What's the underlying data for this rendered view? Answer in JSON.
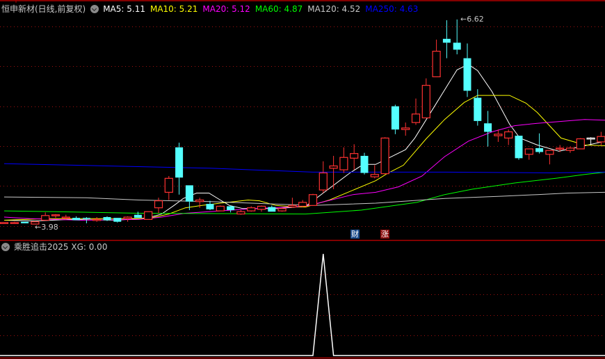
{
  "header": {
    "title": "恒申新材(日线,前复权)",
    "ma": [
      {
        "label": "MA5: 5.11",
        "color": "#ffffff"
      },
      {
        "label": "MA10: 5.21",
        "color": "#ffff00"
      },
      {
        "label": "MA20: 5.12",
        "color": "#ff00ff"
      },
      {
        "label": "MA60: 4.87",
        "color": "#00ff00"
      },
      {
        "label": "MA120: 4.52",
        "color": "#c8c8c8"
      },
      {
        "label": "MA250: 4.63",
        "color": "#0000ff"
      }
    ]
  },
  "markers": {
    "high": "6.62",
    "low": "3.98"
  },
  "badges": {
    "cai": "财",
    "zhang": "涨"
  },
  "indicator": {
    "label": "乘胜追击2025 XG: 0.00"
  },
  "colors": {
    "up": "#ff3232",
    "down": "#54ffff",
    "grid": "#8b0000",
    "separator": "#b00000"
  },
  "chart_data": {
    "type": "candlestick",
    "ohlc": [
      [
        3.99,
        4.0,
        3.99,
        4.0
      ],
      [
        3.99,
        4.01,
        3.99,
        4.0
      ],
      [
        4.01,
        4.01,
        3.99,
        3.99
      ],
      [
        3.98,
        4.01,
        3.98,
        4.01
      ],
      [
        4.03,
        4.13,
        4.03,
        4.09
      ],
      [
        4.09,
        4.11,
        4.06,
        4.1
      ],
      [
        4.07,
        4.1,
        4.04,
        4.07
      ],
      [
        4.06,
        4.08,
        4.03,
        4.03
      ],
      [
        4.06,
        4.07,
        3.99,
        4.05
      ],
      [
        4.03,
        4.07,
        4.01,
        4.04
      ],
      [
        4.07,
        4.08,
        4.02,
        4.03
      ],
      [
        4.06,
        4.06,
        4.0,
        4.01
      ],
      [
        4.05,
        4.08,
        4.01,
        4.07
      ],
      [
        4.1,
        4.14,
        4.06,
        4.06
      ],
      [
        4.04,
        4.14,
        4.04,
        4.14
      ],
      [
        4.19,
        4.32,
        4.12,
        4.28
      ],
      [
        4.39,
        4.6,
        4.29,
        4.57
      ],
      [
        4.97,
        5.03,
        4.36,
        4.58
      ],
      [
        4.48,
        4.48,
        4.16,
        4.27
      ],
      [
        4.27,
        4.32,
        4.19,
        4.29
      ],
      [
        4.24,
        4.28,
        4.16,
        4.17
      ],
      [
        4.15,
        4.22,
        4.15,
        4.21
      ],
      [
        4.21,
        4.22,
        4.13,
        4.16
      ],
      [
        4.11,
        4.16,
        4.1,
        4.14
      ],
      [
        4.15,
        4.21,
        4.14,
        4.19
      ],
      [
        4.17,
        4.22,
        4.14,
        4.21
      ],
      [
        4.2,
        4.22,
        4.14,
        4.14
      ],
      [
        4.15,
        4.19,
        4.14,
        4.18
      ],
      [
        4.2,
        4.32,
        4.19,
        4.22
      ],
      [
        4.21,
        4.29,
        4.2,
        4.26
      ],
      [
        4.22,
        4.37,
        4.22,
        4.36
      ],
      [
        4.42,
        4.79,
        4.38,
        4.64
      ],
      [
        4.7,
        4.86,
        4.43,
        4.73
      ],
      [
        4.68,
        4.97,
        4.64,
        4.84
      ],
      [
        4.83,
        5.01,
        4.68,
        4.89
      ],
      [
        4.86,
        4.9,
        4.62,
        4.64
      ],
      [
        4.59,
        4.74,
        4.57,
        4.62
      ],
      [
        4.63,
        5.1,
        4.63,
        5.09
      ],
      [
        5.5,
        5.52,
        5.14,
        5.2
      ],
      [
        5.2,
        5.29,
        5.12,
        5.22
      ],
      [
        5.29,
        5.6,
        5.26,
        5.4
      ],
      [
        5.35,
        5.86,
        5.35,
        5.77
      ],
      [
        5.88,
        6.36,
        5.88,
        6.21
      ],
      [
        6.37,
        6.61,
        6.12,
        6.32
      ],
      [
        6.32,
        6.62,
        6.17,
        6.23
      ],
      [
        6.12,
        6.31,
        5.62,
        5.7
      ],
      [
        5.61,
        5.72,
        5.25,
        5.31
      ],
      [
        5.28,
        5.44,
        4.98,
        5.17
      ],
      [
        5.12,
        5.2,
        5.04,
        5.14
      ],
      [
        5.09,
        5.2,
        5.0,
        5.17
      ],
      [
        5.12,
        5.12,
        4.81,
        4.83
      ],
      [
        4.88,
        4.95,
        4.81,
        4.95
      ],
      [
        4.96,
        5.15,
        4.89,
        4.91
      ],
      [
        4.88,
        4.93,
        4.75,
        4.93
      ],
      [
        4.96,
        5.0,
        4.91,
        4.96
      ],
      [
        4.93,
        4.98,
        4.9,
        4.96
      ],
      [
        4.95,
        5.09,
        4.95,
        5.08
      ],
      [
        5.09,
        5.1,
        5.0,
        5.09
      ],
      [
        5.04,
        5.17,
        5.0,
        5.11
      ]
    ],
    "ma_lines": [
      {
        "name": "MA5",
        "color": "#ffffff",
        "points": [
          [
            0,
            4.03
          ],
          [
            3,
            4.02
          ],
          [
            6.4,
            4.04
          ],
          [
            10.9,
            4.03
          ],
          [
            14,
            4.06
          ],
          [
            15.3,
            4.11
          ],
          [
            16.5,
            4.22
          ],
          [
            17.4,
            4.31
          ],
          [
            18.7,
            4.38
          ],
          [
            19.9,
            4.38
          ],
          [
            21,
            4.29
          ],
          [
            21.9,
            4.22
          ],
          [
            23.2,
            4.18
          ],
          [
            26.6,
            4.18
          ],
          [
            29.3,
            4.21
          ],
          [
            33.6,
            4.64
          ],
          [
            34.9,
            4.75
          ],
          [
            36.1,
            4.75
          ],
          [
            39,
            4.94
          ],
          [
            39.9,
            5.09
          ],
          [
            42,
            5.54
          ],
          [
            44,
            5.97
          ],
          [
            45.1,
            6.04
          ],
          [
            46,
            5.96
          ],
          [
            47.4,
            5.69
          ],
          [
            49.1,
            5.27
          ],
          [
            50.1,
            5.09
          ],
          [
            51.8,
            5.0
          ],
          [
            53.9,
            4.92
          ],
          [
            56.4,
            4.99
          ],
          [
            58.4,
            5.05
          ]
        ]
      },
      {
        "name": "MA10",
        "color": "#ffff00",
        "points": [
          [
            0,
            4.03
          ],
          [
            4.1,
            4.05
          ],
          [
            8.6,
            4.05
          ],
          [
            13.1,
            4.05
          ],
          [
            14.3,
            4.06
          ],
          [
            16,
            4.11
          ],
          [
            17.6,
            4.19
          ],
          [
            19.2,
            4.22
          ],
          [
            21,
            4.25
          ],
          [
            22.4,
            4.27
          ],
          [
            23.7,
            4.29
          ],
          [
            24.8,
            4.28
          ],
          [
            26.4,
            4.22
          ],
          [
            28.4,
            4.2
          ],
          [
            29.3,
            4.2
          ],
          [
            31.6,
            4.29
          ],
          [
            36.1,
            4.54
          ],
          [
            37.2,
            4.63
          ],
          [
            38.8,
            4.74
          ],
          [
            41,
            5.08
          ],
          [
            42.8,
            5.33
          ],
          [
            44.7,
            5.55
          ],
          [
            46,
            5.64
          ],
          [
            49.1,
            5.64
          ],
          [
            50.7,
            5.54
          ],
          [
            51.8,
            5.42
          ],
          [
            54.1,
            5.09
          ],
          [
            56.4,
            5.0
          ],
          [
            58.4,
            4.99
          ]
        ]
      },
      {
        "name": "MA20",
        "color": "#ff00ff",
        "points": [
          [
            0,
            4.07
          ],
          [
            2.5,
            4.05
          ],
          [
            7.5,
            4.03
          ],
          [
            13.1,
            4.04
          ],
          [
            15.3,
            4.07
          ],
          [
            17.6,
            4.12
          ],
          [
            19.9,
            4.14
          ],
          [
            22.1,
            4.16
          ],
          [
            24.4,
            4.18
          ],
          [
            27.8,
            4.2
          ],
          [
            29.3,
            4.21
          ],
          [
            33.9,
            4.36
          ],
          [
            36.1,
            4.39
          ],
          [
            38.3,
            4.46
          ],
          [
            40.6,
            4.6
          ],
          [
            42.8,
            4.85
          ],
          [
            45.1,
            5.05
          ],
          [
            47.4,
            5.17
          ],
          [
            49.6,
            5.25
          ],
          [
            51.8,
            5.28
          ],
          [
            56.4,
            5.33
          ],
          [
            58.4,
            5.32
          ]
        ]
      },
      {
        "name": "MA60",
        "color": "#00ff00",
        "points": [
          [
            0,
            4.15
          ],
          [
            5,
            4.14
          ],
          [
            13.1,
            4.12
          ],
          [
            29.3,
            4.11
          ],
          [
            34.7,
            4.16
          ],
          [
            40.1,
            4.26
          ],
          [
            42.8,
            4.36
          ],
          [
            45.5,
            4.43
          ],
          [
            49.6,
            4.51
          ],
          [
            53.6,
            4.57
          ],
          [
            56.4,
            4.62
          ],
          [
            58.4,
            4.65
          ]
        ]
      },
      {
        "name": "MA120",
        "color": "#c8c8c8",
        "points": [
          [
            0,
            4.33
          ],
          [
            8,
            4.32
          ],
          [
            13.1,
            4.29
          ],
          [
            20,
            4.27
          ],
          [
            30,
            4.22
          ],
          [
            36.1,
            4.25
          ],
          [
            42.8,
            4.31
          ],
          [
            48.4,
            4.34
          ],
          [
            51.8,
            4.36
          ],
          [
            54.8,
            4.38
          ],
          [
            58.4,
            4.39
          ]
        ]
      },
      {
        "name": "MA250",
        "color": "#0000ff",
        "points": [
          [
            0,
            4.76
          ],
          [
            10,
            4.73
          ],
          [
            20,
            4.7
          ],
          [
            30,
            4.65
          ],
          [
            43,
            4.65
          ],
          [
            53,
            4.64
          ],
          [
            58.4,
            4.65
          ]
        ]
      }
    ],
    "indicator_xg": {
      "name": "XG",
      "spike_index": 31,
      "ylim": [
        0,
        1
      ]
    },
    "ylim": [
      3.98,
      6.62
    ]
  }
}
